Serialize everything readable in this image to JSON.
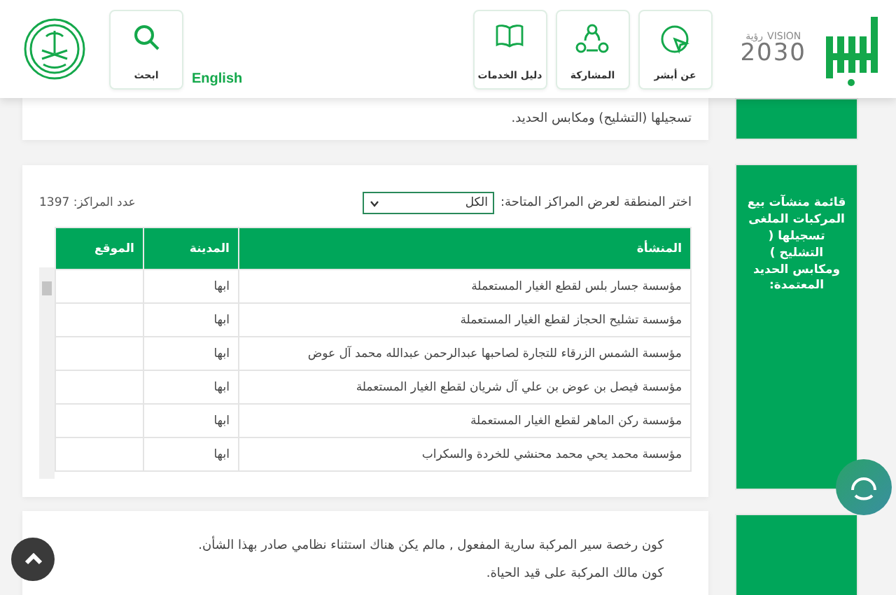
{
  "header": {
    "vision_logo": {
      "word": "VISION",
      "arabic": "رؤية",
      "year": "2030"
    },
    "nav": [
      {
        "label": "عن أبشر",
        "kind": "pointer"
      },
      {
        "label": "المشاركة",
        "kind": "share"
      },
      {
        "label": "دليل الخدمات",
        "kind": "book"
      }
    ],
    "language_link": "English",
    "search": {
      "label": "ابحث"
    }
  },
  "intro_text": "تسجيلها (التشليح) ومكابس الحديد.",
  "filter": {
    "label": "اختر المنطقة لعرض المراكز المتاحة:",
    "value": "الكل",
    "count": "عدد المراكز: 1397"
  },
  "table": {
    "columns": [
      "المنشأة",
      "المدينة",
      "الموقع"
    ],
    "rows": [
      {
        "name": "مؤسسة جسار بلس لقطع الغيار المستعملة",
        "city": "ابها"
      },
      {
        "name": "مؤسسة تشليح الحجاز لقطع الغيار المستعملة",
        "city": "ابها"
      },
      {
        "name": "مؤسسة الشمس الزرقاء للتجارة لصاحبها عبدالرحمن عبدالله محمد آل عوض",
        "city": "ابها"
      },
      {
        "name": "مؤسسة فيصل بن عوض بن علي آل شريان لقطع الغيار المستعملة",
        "city": "ابها"
      },
      {
        "name": "مؤسسة ركن الماهر لقطع الغيار المستعملة",
        "city": "ابها"
      },
      {
        "name": "مؤسسة محمد يحي محمد محنشي للخردة والسكراب",
        "city": "ابها"
      }
    ]
  },
  "sidebar_title": "قائمة منشآت بيع المركبات الملغى تسجيلها ( التشليح ) ومكابس الحديد المعتمدة:",
  "conditions": [
    "كون رخصة سير المركبة سارية المفعول , مالم يكن هناك استثناء نظامي صادر بهذا الشأن.",
    "كون مالك المركبة على قيد الحياة."
  ]
}
